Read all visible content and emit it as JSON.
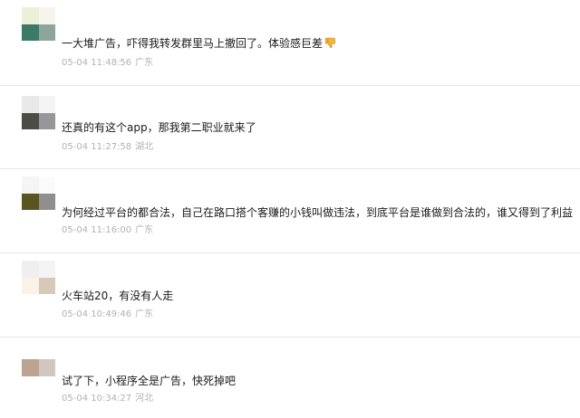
{
  "comments": [
    {
      "text": "一大堆广告，吓得我转发群里马上撤回了。体验感巨差",
      "emoji": "thumbs-down-icon",
      "time": "05-04 11:48:56",
      "location": "广东",
      "avatar_colors": [
        "#ecf0d6",
        "#f6f4ec",
        "#3a7a66",
        "#8ea59c"
      ]
    },
    {
      "text": "还真的有这个app，那我第二职业就来了",
      "time": "05-04 11:27:58",
      "location": "湖北",
      "avatar_colors": [
        "#e9e9e9",
        "#f4f4f4",
        "#4a4d44",
        "#97979b"
      ]
    },
    {
      "text": "为何经过平台的都合法，自己在路口搭个客赚的小钱叫做违法，到底平台是谁做到合法的，谁又得到了利益",
      "time": "05-04 11:16:00",
      "location": "广东",
      "avatar_colors": [
        "#f5f5f5",
        "#fbfbfb",
        "#5a5420",
        "#8f8f8f"
      ]
    },
    {
      "text": "火车站20，有没有人走",
      "time": "05-04 10:49:46",
      "location": "广东",
      "avatar_colors": [
        "#efefef",
        "#f4f4f4",
        "#fbf3e6",
        "#d8c8b9"
      ]
    },
    {
      "text": "试了下，小程序全是广告，快死掉吧",
      "time": "05-04 10:34:27",
      "location": "河北",
      "avatar_colors": [
        "#bca491",
        "#d0c8c0",
        "#ffffff",
        "#ffffff"
      ]
    }
  ]
}
